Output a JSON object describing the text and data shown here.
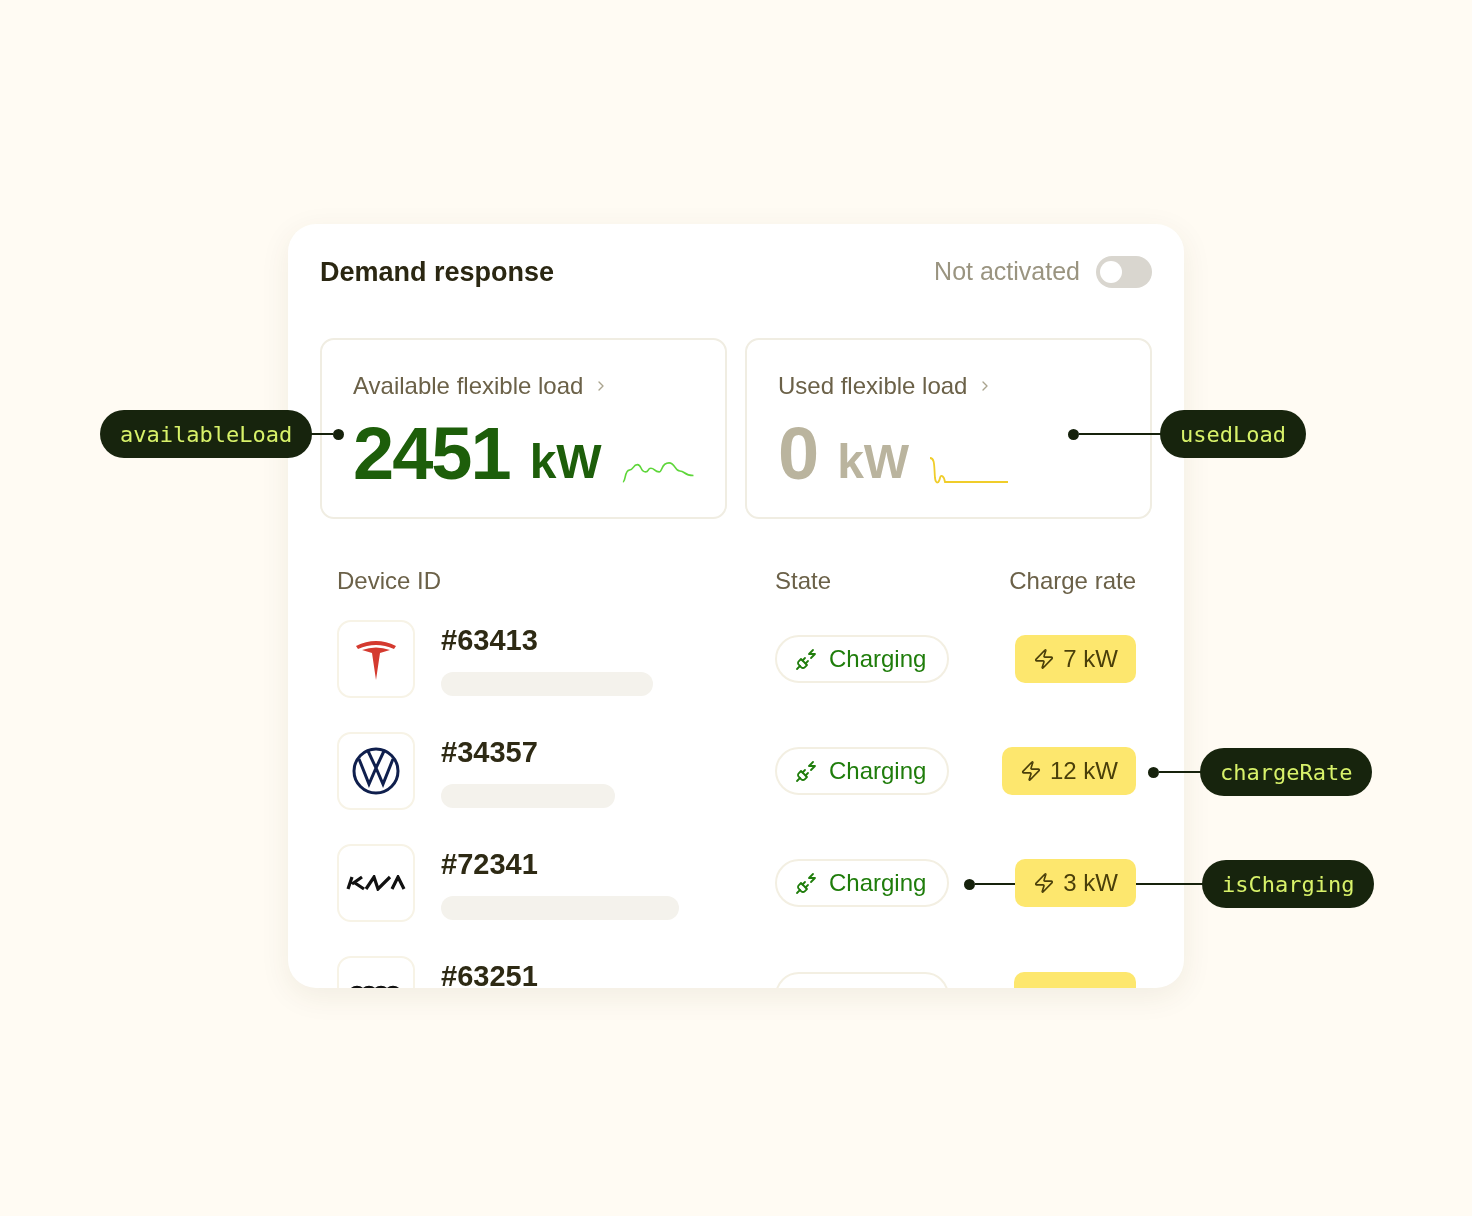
{
  "card": {
    "title": "Demand response",
    "activation": {
      "label": "Not activated",
      "on": false
    }
  },
  "stats": [
    {
      "label": "Available flexible load",
      "value": "2451",
      "unit": "kW",
      "kind": "available"
    },
    {
      "label": "Used flexible load",
      "value": "0",
      "unit": "kW",
      "kind": "used"
    }
  ],
  "table": {
    "columns": [
      "Device ID",
      "State",
      "Charge rate"
    ],
    "rows": [
      {
        "logo": {
          "kind": "tesla"
        },
        "id": "#63413",
        "state": "Charging",
        "rate": "7 kW"
      },
      {
        "logo": {
          "kind": "vw"
        },
        "id": "#34357",
        "state": "Charging",
        "rate": "12 kW"
      },
      {
        "logo": {
          "kind": "kia"
        },
        "id": "#72341",
        "state": "Charging",
        "rate": "3 kW"
      },
      {
        "logo": {
          "kind": "rings"
        },
        "id": "#63251",
        "kind": "partial"
      }
    ]
  },
  "annotations": [
    {
      "label": "availableLoad",
      "kind": "available"
    },
    {
      "label": "usedLoad",
      "kind": "used"
    },
    {
      "label": "chargeRate",
      "kind": "rate"
    },
    {
      "label": "isCharging",
      "kind": "state"
    }
  ]
}
